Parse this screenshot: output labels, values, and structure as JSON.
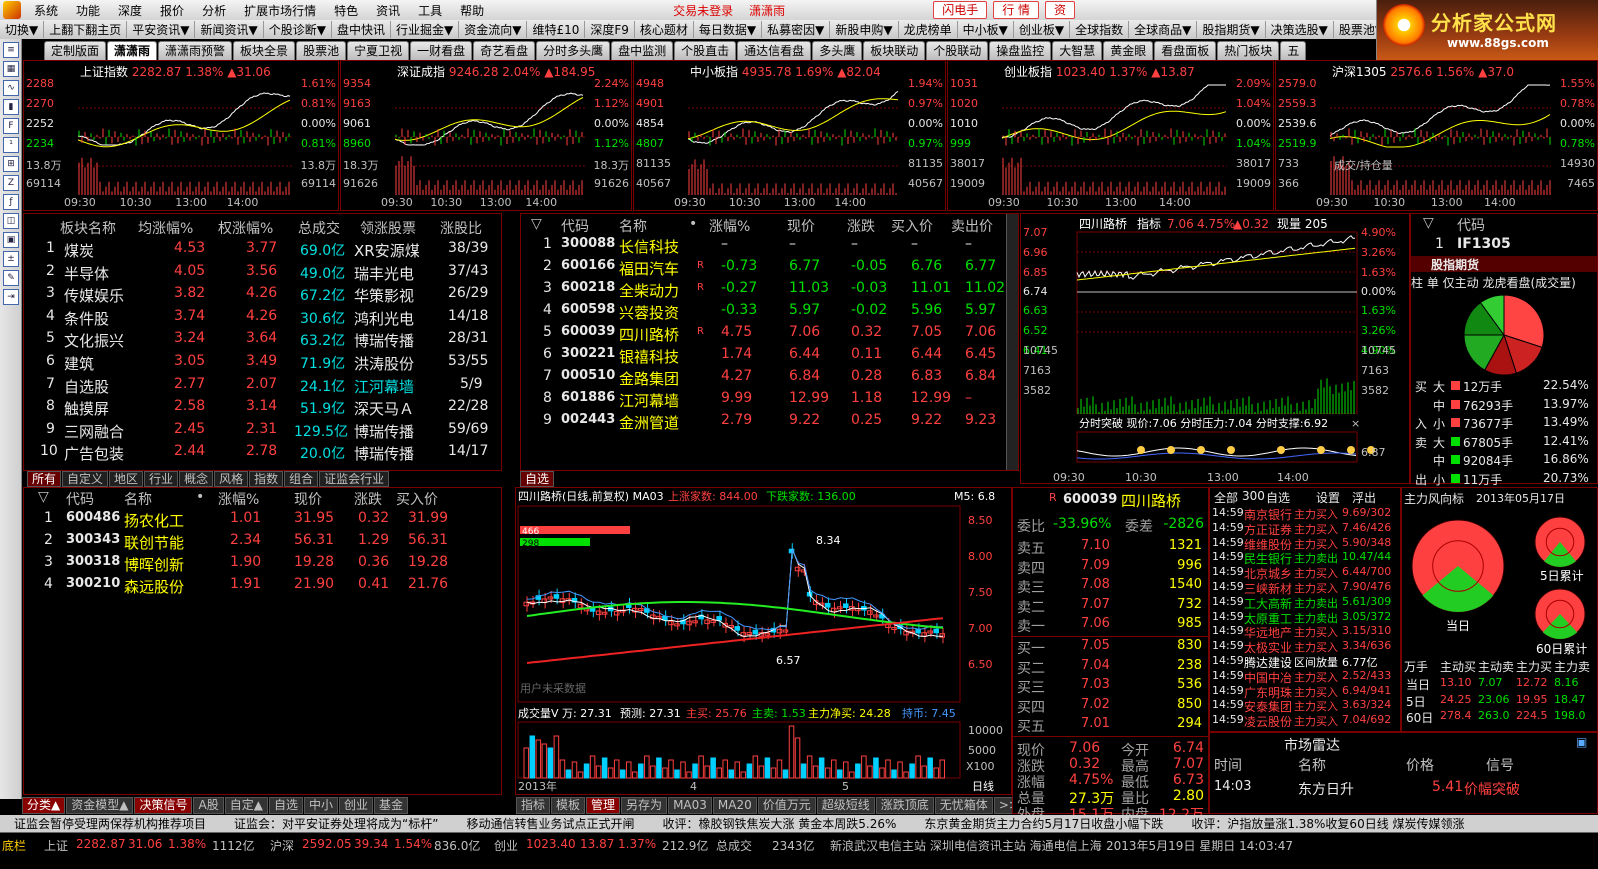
{
  "menu": {
    "items": [
      "系统",
      "功能",
      "深度",
      "报价",
      "分析",
      "扩展市场行情",
      "特色",
      "资讯",
      "工具",
      "帮助"
    ],
    "login": "交易未登录",
    "user": "潇潇雨",
    "btn1": "闪电手",
    "btn2": "行  情",
    "btn3": "资"
  },
  "brand": {
    "title": "分析家公式网",
    "url": "www.88gs.com"
  },
  "toolbar": [
    "切换▼",
    "上翻下翻主页",
    "平安资讯▼",
    "新闻资讯▼",
    "个股诊断▼",
    "盘中快讯",
    "行业掘金▼",
    "资金流向▼",
    "维特£10",
    "深度F9",
    "核心题材",
    "每日数据▼",
    "私募密因▼",
    "新股申购▼",
    "龙虎榜单",
    "中小板▼",
    "创业板▼",
    "全球指数",
    "全球商品▼",
    "股指期货▼",
    "决策选股▼",
    "股票池▼"
  ],
  "tabs": [
    "定制版面",
    "潇潇雨",
    "潇潇雨预警",
    "板块全景",
    "股票池",
    "宁夏卫视",
    "一财看盘",
    "奇艺看盘",
    "分时多头鹰",
    "盘中监测",
    "个股直击",
    "通达信看盘",
    "多头鹰",
    "板块联动",
    "个股联动",
    "操盘监控",
    "大智慧",
    "黄金眼",
    "看盘面板",
    "热门板块",
    "五"
  ],
  "minis": [
    {
      "name": "上证指数",
      "price": "2282.87",
      "pct": "1.38%",
      "chg": "▲31.06",
      "left": [
        "2288",
        "2270",
        "2252",
        "2234",
        "13.8万",
        "69114"
      ],
      "right": [
        "1.61%",
        "0.81%",
        "0.00%",
        "0.81%",
        "13.8万",
        "69114"
      ],
      "times": [
        "09:30",
        "10:30",
        "13:00",
        "14:00"
      ]
    },
    {
      "name": "深证成指",
      "price": "9246.28",
      "pct": "2.04%",
      "chg": "▲184.95",
      "left": [
        "9354",
        "9163",
        "9061",
        "8960",
        "18.3万",
        "91626"
      ],
      "right": [
        "2.24%",
        "1.12%",
        "0.00%",
        "1.12%",
        "18.3万",
        "91626"
      ],
      "times": [
        "09:30",
        "10:30",
        "13:00",
        "14:00"
      ]
    },
    {
      "name": "中小板指",
      "price": "4935.78",
      "pct": "1.69%",
      "chg": "▲82.04",
      "left": [
        "4948",
        "4901",
        "4854",
        "4807",
        "81135",
        "40567"
      ],
      "right": [
        "1.94%",
        "0.97%",
        "0.00%",
        "0.97%",
        "81135",
        "40567"
      ],
      "times": [
        "09:30",
        "10:30",
        "13:00",
        "14:00"
      ]
    },
    {
      "name": "创业板指",
      "price": "1023.40",
      "pct": "1.37%",
      "chg": "▲13.87",
      "left": [
        "1031",
        "1020",
        "1010",
        "999",
        "38017",
        "19009"
      ],
      "right": [
        "2.09%",
        "1.04%",
        "0.00%",
        "1.04%",
        "38017",
        "19009"
      ],
      "times": [
        "09:30",
        "10:30",
        "13:00",
        "14:00"
      ]
    },
    {
      "name": "沪深1305",
      "price": "2576.6",
      "pct": "1.56%",
      "chg": "▲37.0",
      "left": [
        "2579.0",
        "2559.3",
        "2539.6",
        "2519.9",
        "733",
        "366"
      ],
      "right": [
        "1.55%",
        "0.78%",
        "0.00%",
        "0.78%",
        "14930",
        "7465"
      ],
      "times": [
        "09:30",
        "10:30",
        "13:00",
        "14:00"
      ],
      "label": "成交/持仓量"
    }
  ],
  "sectors": {
    "headers": [
      "板块名称",
      "均涨幅%",
      "权涨幅%",
      "总成交",
      "领涨股票",
      "涨股比"
    ],
    "rows": [
      [
        "1",
        "煤炭",
        "4.53",
        "3.77",
        "69.0亿",
        "XR安源煤",
        "38/39"
      ],
      [
        "2",
        "半导体",
        "4.05",
        "3.56",
        "49.0亿",
        "瑞丰光电",
        "37/43"
      ],
      [
        "3",
        "传媒娱乐",
        "3.82",
        "4.26",
        "67.2亿",
        "华策影视",
        "26/29"
      ],
      [
        "4",
        "条件股",
        "3.74",
        "4.26",
        "30.6亿",
        "鸿利光电",
        "14/18"
      ],
      [
        "5",
        "文化振兴",
        "3.24",
        "3.64",
        "63.2亿",
        "博瑞传播",
        "28/31"
      ],
      [
        "6",
        "建筑",
        "3.05",
        "3.49",
        "71.9亿",
        "洪涛股份",
        "53/55"
      ],
      [
        "7",
        "自选股",
        "2.77",
        "2.07",
        "24.1亿",
        "江河幕墙",
        "5/9"
      ],
      [
        "8",
        "触摸屏",
        "2.58",
        "3.14",
        "51.9亿",
        "深天马Ａ",
        "22/28"
      ],
      [
        "9",
        "三网融合",
        "2.45",
        "2.31",
        "129.5亿",
        "博瑞传播",
        "59/69"
      ],
      [
        "10",
        "广告包装",
        "2.44",
        "2.78",
        "20.0亿",
        "博瑞传播",
        "14/17"
      ]
    ],
    "tabs": [
      "所有",
      "自定义",
      "地区",
      "行业",
      "概念",
      "风格",
      "指数",
      "组合",
      "证监会行业"
    ]
  },
  "watch1": {
    "headers": [
      "代码",
      "名称",
      "•",
      "涨幅%",
      "现价",
      "涨跌",
      "买入价",
      "卖出价"
    ],
    "rows": [
      [
        "1",
        "300088",
        "长信科技",
        "",
        "–",
        "–",
        "–",
        "–",
        "–"
      ],
      [
        "2",
        "600166",
        "福田汽车",
        "R",
        "-0.73",
        "6.77",
        "-0.05",
        "6.76",
        "6.77"
      ],
      [
        "3",
        "600218",
        "全柴动力",
        "R",
        "-0.27",
        "11.03",
        "-0.03",
        "11.01",
        "11.02"
      ],
      [
        "4",
        "600598",
        "兴蓉投资",
        "",
        "-0.33",
        "5.97",
        "-0.02",
        "5.96",
        "5.97"
      ],
      [
        "5",
        "600039",
        "四川路桥",
        "R",
        "4.75",
        "7.06",
        "0.32",
        "7.05",
        "7.06"
      ],
      [
        "6",
        "300221",
        "银禧科技",
        "",
        "1.74",
        "6.44",
        "0.11",
        "6.44",
        "6.45"
      ],
      [
        "7",
        "000510",
        "金路集团",
        "",
        "4.27",
        "6.84",
        "0.28",
        "6.83",
        "6.84"
      ],
      [
        "8",
        "601886",
        "江河幕墙",
        "",
        "9.99",
        "12.99",
        "1.18",
        "12.99",
        "–"
      ],
      [
        "9",
        "002443",
        "金洲管道",
        "",
        "2.79",
        "9.22",
        "0.25",
        "9.22",
        "9.23"
      ]
    ],
    "tab": "自选"
  },
  "watch2": {
    "headers": [
      "代码",
      "名称",
      "•",
      "涨幅%",
      "现价",
      "涨跌",
      "买入价"
    ],
    "rows": [
      [
        "1",
        "600486",
        "扬农化工",
        "1.01",
        "31.95",
        "0.32",
        "31.99"
      ],
      [
        "2",
        "300343",
        "联创节能",
        "2.34",
        "56.31",
        "1.29",
        "56.31"
      ],
      [
        "3",
        "300318",
        "博晖创新",
        "1.90",
        "19.28",
        "0.36",
        "19.28"
      ],
      [
        "4",
        "300210",
        "森远股份",
        "1.91",
        "21.90",
        "0.41",
        "21.76"
      ]
    ]
  },
  "intraday": {
    "title": "四川路桥",
    "ind": "指标",
    "price": "7.06",
    "pct": "4.75%",
    "chg": "▲0.32",
    "vol": "现量 205",
    "left": [
      "7.07",
      "6.96",
      "6.85",
      "6.74",
      "6.63",
      "6.52",
      "6.41",
      "10745",
      "7163",
      "3582"
    ],
    "right": [
      "4.90%",
      "3.26%",
      "1.63%",
      "0.00%",
      "1.63%",
      "3.26%",
      "4.90%",
      "10745",
      "7163",
      "3582"
    ],
    "times": [
      "09:30",
      "10:30",
      "13:00",
      "14:00"
    ],
    "info": "分时突破  现价:7.06  分时压力:7.04  分时支撑:6.92",
    "sub": "6.87"
  },
  "futures": {
    "hdr": "代码",
    "row": [
      "1",
      "IF1305"
    ],
    "title": "股指期货",
    "subtabs": [
      "柱",
      "单",
      "仅主动",
      "龙虎看盘(成交量)"
    ],
    "flow": [
      [
        "买",
        "大",
        "12万手",
        "22.54%"
      ],
      [
        "",
        "中",
        "76293手",
        "13.97%"
      ],
      [
        "入",
        "小",
        "73677手",
        "13.49%"
      ],
      [
        "卖",
        "大",
        "67805手",
        "12.41%"
      ],
      [
        "",
        "中",
        "92084手",
        "16.86%"
      ],
      [
        "出",
        "小",
        "11万手",
        "20.73%"
      ]
    ]
  },
  "kline": {
    "title": "四川路桥(日线,前复权) MA03",
    "up": "上涨家数: 844.00",
    "down": "下跌家数: 136.00",
    "m5": "M5: 6.8",
    "axis": [
      "8.50",
      "8.00",
      "7.50",
      "7.00",
      "6.50"
    ],
    "hi": "8.34",
    "lo": "6.57",
    "bar1": "466",
    "bar2": "298",
    "note": "用户未采数据",
    "vol": "成交量V 万: 27.31",
    "pred": "预测: 27.31",
    "buy": "主买: 25.76",
    "sell": "主卖: 1.53",
    "net": "主力净买: 24.28",
    "hold": "持币: 7.45",
    "vaxis": [
      "10000",
      "5000",
      "X100"
    ],
    "year": "2013年",
    "m4": "4",
    "m5l": "5",
    "period": "日线",
    "tabs": [
      "指标",
      "模板",
      "管理",
      "另存为",
      "MA03",
      "MA20",
      "价值万元",
      "超级短线",
      "涨跌顶底",
      "无忧箱体",
      ">>",
      "+",
      "-",
      "Z"
    ]
  },
  "book": {
    "code": "600039",
    "name": "四川路桥",
    "wb": "委比",
    "wbv": "-33.96%",
    "wc": "委差",
    "wcv": "-2826",
    "asks": [
      [
        "卖五",
        "7.10",
        "1321"
      ],
      [
        "卖四",
        "7.09",
        "996"
      ],
      [
        "卖三",
        "7.08",
        "1540"
      ],
      [
        "卖二",
        "7.07",
        "732"
      ],
      [
        "卖一",
        "7.06",
        "985"
      ]
    ],
    "bids": [
      [
        "买一",
        "7.05",
        "830"
      ],
      [
        "买二",
        "7.04",
        "238"
      ],
      [
        "买三",
        "7.03",
        "536"
      ],
      [
        "买四",
        "7.02",
        "850"
      ],
      [
        "买五",
        "7.01",
        "294"
      ]
    ],
    "stats": [
      [
        "现价",
        "7.06",
        "今开",
        "6.74"
      ],
      [
        "涨跌",
        "0.32",
        "最高",
        "7.07"
      ],
      [
        "涨幅",
        "4.75%",
        "最低",
        "6.73"
      ],
      [
        "总量",
        "27.3万",
        "量比",
        "2.80"
      ],
      [
        "外盘",
        "15.1万",
        "内盘",
        "12.2万"
      ]
    ]
  },
  "flowlist": {
    "hdr": [
      "全部",
      "300",
      "自选",
      "设置",
      "浮出"
    ],
    "rows": [
      [
        "14:59",
        "南京银行",
        "主力买入",
        "9.69/302"
      ],
      [
        "14:59",
        "方正证券",
        "主力买入",
        "7.46/426"
      ],
      [
        "14:59",
        "维维股份",
        "主力买入",
        "5.90/348"
      ],
      [
        "14:59",
        "民生银行",
        "主力卖出",
        "10.47/44"
      ],
      [
        "14:59",
        "北京城乡",
        "主力买入",
        "6.44/700"
      ],
      [
        "14:59",
        "三峡新材",
        "主力买入",
        "7.90/476"
      ],
      [
        "14:59",
        "工大高新",
        "主力卖出",
        "5.61/309"
      ],
      [
        "14:59",
        "太原重工",
        "主力卖出",
        "3.05/372"
      ],
      [
        "14:59",
        "华远地产",
        "主力买入",
        "3.15/310"
      ],
      [
        "14:59",
        "太极实业",
        "主力买入",
        "3.34/636"
      ],
      [
        "14:59",
        "腾达建设",
        "区间放量",
        "6.77亿"
      ],
      [
        "14:59",
        "中国中冶",
        "主力买入",
        "2.52/433"
      ],
      [
        "14:59",
        "广东明珠",
        "主力买入",
        "6.94/941"
      ],
      [
        "14:59",
        "安泰集团",
        "主力买入",
        "3.63/324"
      ],
      [
        "14:59",
        "凌云股份",
        "主力买入",
        "7.04/692"
      ]
    ]
  },
  "radar": {
    "title": "主力风向标",
    "date": "2013年05月17日",
    "today": "当日",
    "d5": "5日累计",
    "d60": "60日累计",
    "hdr": [
      "万手",
      "主动买",
      "主动卖",
      "主力买",
      "主力卖"
    ],
    "rows": [
      [
        "当日",
        "13.10",
        "7.07",
        "12.72",
        "8.16"
      ],
      [
        "5日",
        "24.25",
        "23.06",
        "19.95",
        "18.47"
      ],
      [
        "60日",
        "278.4",
        "263.0",
        "224.5",
        "198.0"
      ]
    ]
  },
  "mradar": {
    "title": "市场雷达",
    "hdr": [
      "时间",
      "名称",
      "价格",
      "信号"
    ],
    "row": [
      "14:03",
      "东方日升",
      "5.41",
      "价幅突破"
    ]
  },
  "bottomtabs": {
    "a": [
      "分类▲",
      "资金模型▲",
      "决策信号",
      "A股",
      "自定▲",
      "自选",
      "中小",
      "创业",
      "基金"
    ]
  },
  "ticker": [
    "证监会暂停受理两保荐机构推荐项目",
    "证监会：对平安证券处理将成为“标杆”",
    "移动通信转售业务试点正式开闸",
    "收评：橡胶钢铁焦炭大涨 黄金本周跌5.26%",
    "东京黄金期货主力合约5月17日收盘小幅下跌",
    "收评：沪指放量涨1.38%收复60日线 煤炭传媒领涨"
  ],
  "status": {
    "label": "底栏",
    "sh": "上证",
    "shv": "2282.87",
    "shc": "31.06",
    "shp": "1.38%",
    "sha": "1112亿",
    "sz": "沪深",
    "szv": "2592.05",
    "szc": "39.34",
    "szp": "1.54%",
    "sza": "836.0亿",
    "cy": "创业",
    "cyv": "1023.40",
    "cyc": "13.87",
    "cyp": "1.37%",
    "cya": "212.9亿",
    "tot": "总成交",
    "totv": "2343亿",
    "sites": "新浪武汉电信主站  深圳电信资讯主站  海通电信上海",
    "date": "2013年5月19日 星期日  14:03:47"
  },
  "colors": {
    "up": "#ff4040",
    "down": "#00e000",
    "grid": "#7a0000",
    "bg": "#000000",
    "flat": "#e8e8e8",
    "ma": "#ffff00"
  }
}
